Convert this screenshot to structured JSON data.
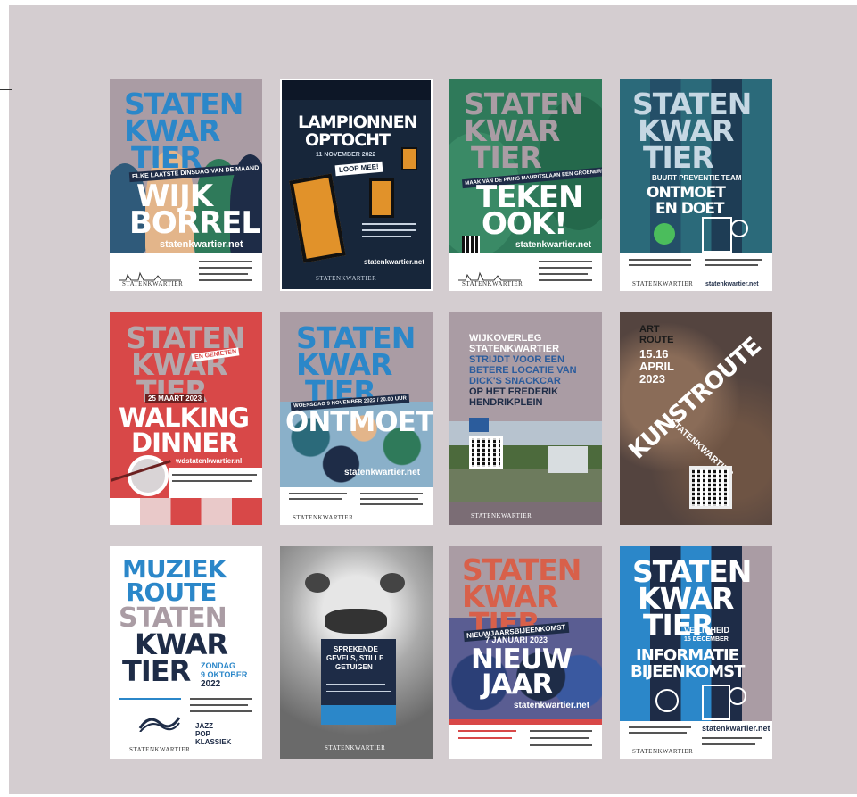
{
  "colors": {
    "background": "#d4cdd0",
    "blue": "#2b87c9",
    "mauve": "#aa9ca4",
    "navy": "#1e2c47",
    "red": "#d84848",
    "teal": "#2b6a7a",
    "green": "#2f7a5a"
  },
  "posters": [
    {
      "lines": [
        "STATEN",
        "KWAR",
        "TIER"
      ],
      "tag": "ELKE LAATSTE DINSDAG VAN DE MAAND",
      "title": [
        "WIJK",
        "BORREL"
      ],
      "url": "statenkwartier.net",
      "logo": "STATENKWARTIER"
    },
    {
      "title": [
        "LAMPIONNEN",
        "OPTOCHT"
      ],
      "date": "11 NOVEMBER 2022",
      "badge": "LOOP MEE!",
      "url": "statenkwartier.net",
      "logo": "STATENKWARTIER"
    },
    {
      "lines": [
        "STATEN",
        "KWAR",
        "TIER"
      ],
      "tag": "MAAK VAN DE PRINS MAURITSLAAN EEN GROENERE, GROENE ZONE",
      "title": [
        "TEKEN",
        "OOK!"
      ],
      "url": "statenkwartier.net",
      "logo": "STATENKWARTIER"
    },
    {
      "lines": [
        "STATEN",
        "KWAR",
        "TIER"
      ],
      "tag": "BUURT PREVENTIE TEAM",
      "title": [
        "ONTMOET",
        "EN DOET"
      ],
      "url": "statenkwartier.net",
      "logo": "STATENKWARTIER"
    },
    {
      "lines": [
        "STATEN",
        "KWAR",
        "TIER"
      ],
      "tag": "EN GENIETEN",
      "date": "25 MAART 2023",
      "title": [
        "WALKING",
        "DINNER"
      ],
      "url": "wdstatenkwartier.nl"
    },
    {
      "lines": [
        "STATEN",
        "KWAR",
        "TIER"
      ],
      "tag": "WOENSDAG 9 NOVEMBER 2022 / 20.00 UUR",
      "title": [
        "ONTMOET"
      ],
      "url": "statenkwartier.net",
      "logo": "STATENKWARTIER"
    },
    {
      "lines": [
        "WIJKOVERLEG",
        "STATENKWARTIER",
        "STRIJDT VOOR EEN",
        "BETERE LOCATIE VAN",
        "DICK'S SNACKCAR",
        "OP HET FREDERIK",
        "HENDRIKPLEIN"
      ],
      "logo": "STATENKWARTIER"
    },
    {
      "lines": [
        "ART",
        "ROUTE",
        "15.16",
        "APRIL",
        "2023"
      ],
      "title": [
        "KUNSTROUTE"
      ],
      "sub": "STATENKWARTIER"
    },
    {
      "lines": [
        "MUZIEK",
        "ROUTE",
        "STATEN",
        "KWAR",
        "TIER"
      ],
      "date": [
        "ZONDAG",
        "9 OKTOBER",
        "2022"
      ],
      "genres": [
        "JAZZ",
        "POP",
        "KLASSIEK"
      ],
      "logo": "STATENKWARTIER"
    },
    {
      "lines": [
        "SPREKENDE",
        "GEVELS, STILLE",
        "GETUIGEN"
      ],
      "logo": "STATENKWARTIER"
    },
    {
      "lines": [
        "STATEN",
        "KWAR",
        "TIER"
      ],
      "tag": "NIEUWJAARSBIJEENKOMST",
      "date": "7 JANUARI 2023",
      "title": [
        "NIEUW",
        "JAAR"
      ],
      "url": "statenkwartier.net"
    },
    {
      "lines": [
        "STATEN",
        "KWAR",
        "TIER"
      ],
      "tag": "VEILIGHEID",
      "date": "15 DECEMBER",
      "title": [
        "INFORMATIE",
        "BIJEENKOMST"
      ],
      "url": "statenkwartier.net",
      "logo": "STATENKWARTIER"
    }
  ]
}
